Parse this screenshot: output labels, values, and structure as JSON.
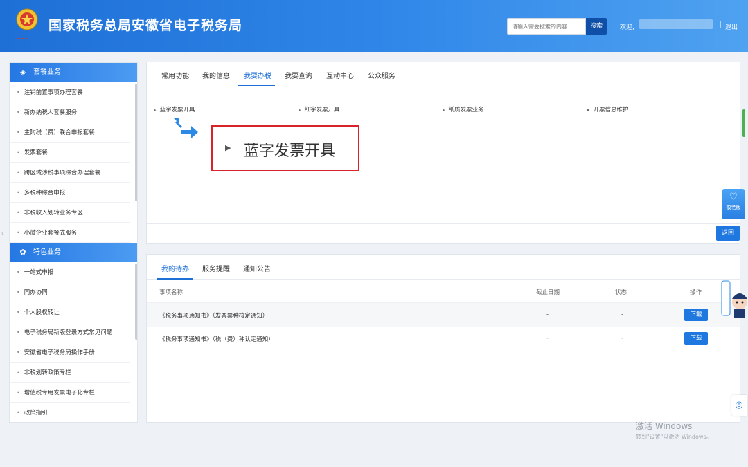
{
  "header": {
    "title": "国家税务总局安徽省电子税务局",
    "search_placeholder": "请输入需要搜索的内容",
    "search_button": "搜索",
    "welcome": "欢迎,",
    "separator": "|",
    "logout": "退出"
  },
  "sidebar": {
    "groups": [
      {
        "title": "套餐业务",
        "icon": "layers-icon",
        "items": [
          "注销前置事项办理套餐",
          "新办纳税人套餐服务",
          "主附税（费）联合申报套餐",
          "发票套餐",
          "跨区域涉税事项综合办理套餐",
          "多税种综合申报",
          "非税收入划转业务专区",
          "小微企业套餐式服务"
        ]
      },
      {
        "title": "特色业务",
        "icon": "flower-icon",
        "items": [
          "一站式申报",
          "同办协同",
          "个人股权转让",
          "电子税务局新版登录方式常见问题",
          "安徽省电子税务局操作手册",
          "非税划转政策专栏",
          "增值税专用发票电子化专栏",
          "政策指引"
        ]
      }
    ]
  },
  "main_tabs": [
    "常用功能",
    "我的信息",
    "我要办税",
    "我要查询",
    "互动中心",
    "公众服务"
  ],
  "active_main_tab": "我要办税",
  "sub_links": [
    "蓝字发票开具",
    "红字发票开具",
    "纸质发票业务",
    "开票信息维护"
  ],
  "callout": {
    "text": "蓝字发票开具"
  },
  "back_button": "返回",
  "elder_mode": "敬老版",
  "todo": {
    "tabs": [
      "我的待办",
      "服务提醒",
      "通知公告"
    ],
    "active_tab": "我的待办",
    "columns": [
      "事项名称",
      "截止日期",
      "状态",
      "操作"
    ],
    "rows": [
      {
        "name": "《税务事项通知书》（发票票种核定通知）",
        "deadline": "-",
        "status": "-",
        "action": "下载"
      },
      {
        "name": "《税务事项通知书》（税（费）种认定通知）",
        "deadline": "-",
        "status": "-",
        "action": "下载"
      }
    ]
  },
  "windows_notice": {
    "title": "激活 Windows",
    "sub": "转到\"设置\"以激活 Windows。"
  },
  "colors": {
    "primary": "#1e6fd6",
    "highlight_border": "#d9232a",
    "button": "#1e78e0"
  }
}
